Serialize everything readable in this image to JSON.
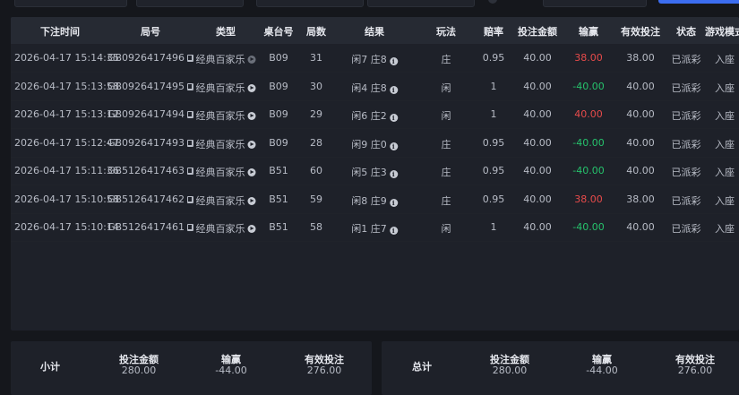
{
  "columns": [
    "下注时间",
    "局号",
    "类型",
    "桌台号",
    "局数",
    "结果",
    "玩法",
    "赔率",
    "投注金额",
    "输赢",
    "有效投注",
    "状态",
    "游戏模式"
  ],
  "rows": [
    {
      "time": "2026-04-17 15:14:35",
      "round": "GB0926417496",
      "type": "经典百家乐",
      "table": "B09",
      "count": "31",
      "result": "闲7 庄8",
      "play": "庄",
      "odds": "0.95",
      "bet": "40.00",
      "win": "38.00",
      "win_sign": "pos",
      "valid": "38.00",
      "status": "已派彩",
      "mode": "入座",
      "icon_dim": true
    },
    {
      "time": "2026-04-17 15:13:58",
      "round": "GB0926417495",
      "type": "经典百家乐",
      "table": "B09",
      "count": "30",
      "result": "闲4 庄8",
      "play": "闲",
      "odds": "1",
      "bet": "40.00",
      "win": "-40.00",
      "win_sign": "neg",
      "valid": "40.00",
      "status": "已派彩",
      "mode": "入座",
      "icon_dim": false
    },
    {
      "time": "2026-04-17 15:13:12",
      "round": "GB0926417494",
      "type": "经典百家乐",
      "table": "B09",
      "count": "29",
      "result": "闲6 庄2",
      "play": "闲",
      "odds": "1",
      "bet": "40.00",
      "win": "40.00",
      "win_sign": "pos",
      "valid": "40.00",
      "status": "已派彩",
      "mode": "入座",
      "icon_dim": false
    },
    {
      "time": "2026-04-17 15:12:47",
      "round": "GB0926417493",
      "type": "经典百家乐",
      "table": "B09",
      "count": "28",
      "result": "闲9 庄0",
      "play": "庄",
      "odds": "0.95",
      "bet": "40.00",
      "win": "-40.00",
      "win_sign": "neg",
      "valid": "40.00",
      "status": "已派彩",
      "mode": "入座",
      "icon_dim": false
    },
    {
      "time": "2026-04-17 15:11:36",
      "round": "GB5126417463",
      "type": "经典百家乐",
      "table": "B51",
      "count": "60",
      "result": "闲5 庄3",
      "play": "庄",
      "odds": "0.95",
      "bet": "40.00",
      "win": "-40.00",
      "win_sign": "neg",
      "valid": "40.00",
      "status": "已派彩",
      "mode": "入座",
      "icon_dim": false
    },
    {
      "time": "2026-04-17 15:10:58",
      "round": "GB5126417462",
      "type": "经典百家乐",
      "table": "B51",
      "count": "59",
      "result": "闲8 庄9",
      "play": "庄",
      "odds": "0.95",
      "bet": "40.00",
      "win": "38.00",
      "win_sign": "pos",
      "valid": "38.00",
      "status": "已派彩",
      "mode": "入座",
      "icon_dim": false
    },
    {
      "time": "2026-04-17 15:10:14",
      "round": "GB5126417461",
      "type": "经典百家乐",
      "table": "B51",
      "count": "58",
      "result": "闲1 庄7",
      "play": "闲",
      "odds": "1",
      "bet": "40.00",
      "win": "-40.00",
      "win_sign": "neg",
      "valid": "40.00",
      "status": "已派彩",
      "mode": "入座",
      "icon_dim": false
    }
  ],
  "subtotal": {
    "label": "小计",
    "bet_label": "投注金额",
    "bet": "280.00",
    "win_label": "输赢",
    "win": "-44.00",
    "valid_label": "有效投注",
    "valid": "276.00"
  },
  "total": {
    "label": "总计",
    "bet_label": "投注金额",
    "bet": "280.00",
    "win_label": "输赢",
    "win": "-44.00",
    "valid_label": "有效投注",
    "valid": "276.00"
  },
  "colors": {
    "positive": "#e84b4b",
    "negative": "#26c26c",
    "accent": "#3c6df0"
  }
}
